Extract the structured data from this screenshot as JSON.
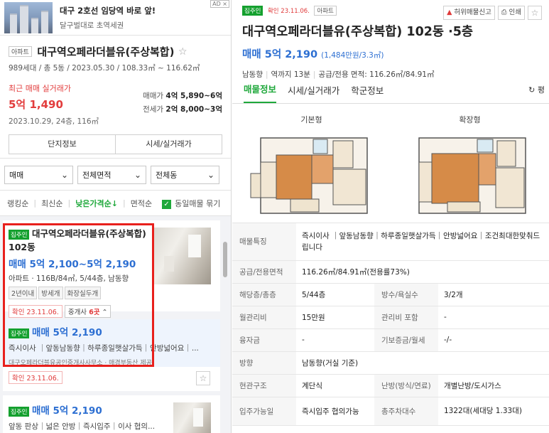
{
  "ad": {
    "badge": "AD ×",
    "title": "대구 2호선 임당역 바로 앞!",
    "subtitle": "달구벌대로 초역세권"
  },
  "complex": {
    "tag": "아파트",
    "name": "대구역오페라더블유(주상복합)",
    "info": "989세대 / 총 5동 / 2023.05.30 / 108.33㎡ ~ 116.62㎡",
    "recent_label": "최근 매매 실거래가",
    "recent_price": "5억 1,490",
    "recent_date": "2023.10.29, 24층, 116㎡",
    "sale_label": "매매가",
    "sale_value": "4억 5,890~6억",
    "jeonse_label": "전세가",
    "jeonse_value": "2억 8,000~3억",
    "btn_info": "단지정보",
    "btn_price": "시세/실거래가"
  },
  "filters": {
    "deal": "매매",
    "area": "전체면적",
    "building": "전체동"
  },
  "sorts": {
    "ranking": "랭킹순",
    "latest": "최신순",
    "low_price": "낮은가격순↓",
    "area": "면적순",
    "bundle": "동일매물 묶기"
  },
  "listings": [
    {
      "tag": "집주인",
      "title": "대구역오페라더블유(주상복합) 102동",
      "price": "매매 5억 2,100~5억 2,190",
      "desc": "아파트 · 116B/84㎡, 5/44층, 남동향",
      "chips": [
        "2년이내",
        "방세개",
        "화장실두개"
      ],
      "confirm": "확인 23.11.06.",
      "agent_prefix": "중개사",
      "agent_count": "6곳"
    },
    {
      "tag": "집주인",
      "price": "매매 5억 2,190",
      "desc": "즉시이사 ｜앞동남동향｜하루종일햇살가득｜안방넓어요｜...",
      "sub": "대구오페라더블유공인중개사사무소 · 매경부동산 제공",
      "confirm": "확인 23.11.06."
    },
    {
      "tag": "집주인",
      "price": "매매 5억 2,190",
      "desc": "앞동 판상｜넓은 안방｜즉시입주｜이사 협의..."
    }
  ],
  "detail": {
    "tag": "집주인",
    "confirm": "확인 23.11.06.",
    "kind": "아파트",
    "report_label": "허위매물신고",
    "print_label": "인쇄",
    "title": "대구역오페라더블유(주상복합) 102동 ·5층",
    "price": "매매 5억 2,190",
    "price_per": "(1,484만원/3.3㎡)",
    "info_dir": "남동향",
    "info_station": "역까지 13분",
    "info_area": "공급/전용 면적: 116.26㎡/84.91㎡",
    "tabs": [
      "매물정보",
      "시세/실거래가",
      "학군정보"
    ],
    "share_label": "평",
    "plan_basic": "기본형",
    "plan_ext": "확장형"
  },
  "specs": [
    {
      "k": "매물특징",
      "v": "즉시이사 ｜앞동남동향｜하루종일햇살가득｜안방넓어요｜조건최대한맞춰드립니다"
    },
    {
      "k": "공급/전용면적",
      "v": "116.26㎡/84.91㎡(전용률73%)"
    },
    {
      "k": "해당층/총층",
      "v": "5/44층",
      "k2": "방수/욕실수",
      "v2": "3/2개"
    },
    {
      "k": "월관리비",
      "v": "15만원",
      "k2": "관리비 포함",
      "v2": "-"
    },
    {
      "k": "융자금",
      "v": "-",
      "k2": "기보증금/월세",
      "v2": "-/-"
    },
    {
      "k": "방향",
      "v": "남동향(거실 기준)"
    },
    {
      "k": "현관구조",
      "v": "계단식",
      "k2": "난방(방식/연료)",
      "v2": "개별난방/도시가스"
    },
    {
      "k": "입주가능일",
      "v": "즉시입주 협의가능",
      "k2": "총주차대수",
      "v2": "1322대(세대당 1.33대)"
    }
  ],
  "colors": {
    "accent_green": "#1fa83b",
    "price_blue": "#2d6fd2",
    "red": "#e23d3d",
    "highlight_box": "#e8201c"
  }
}
